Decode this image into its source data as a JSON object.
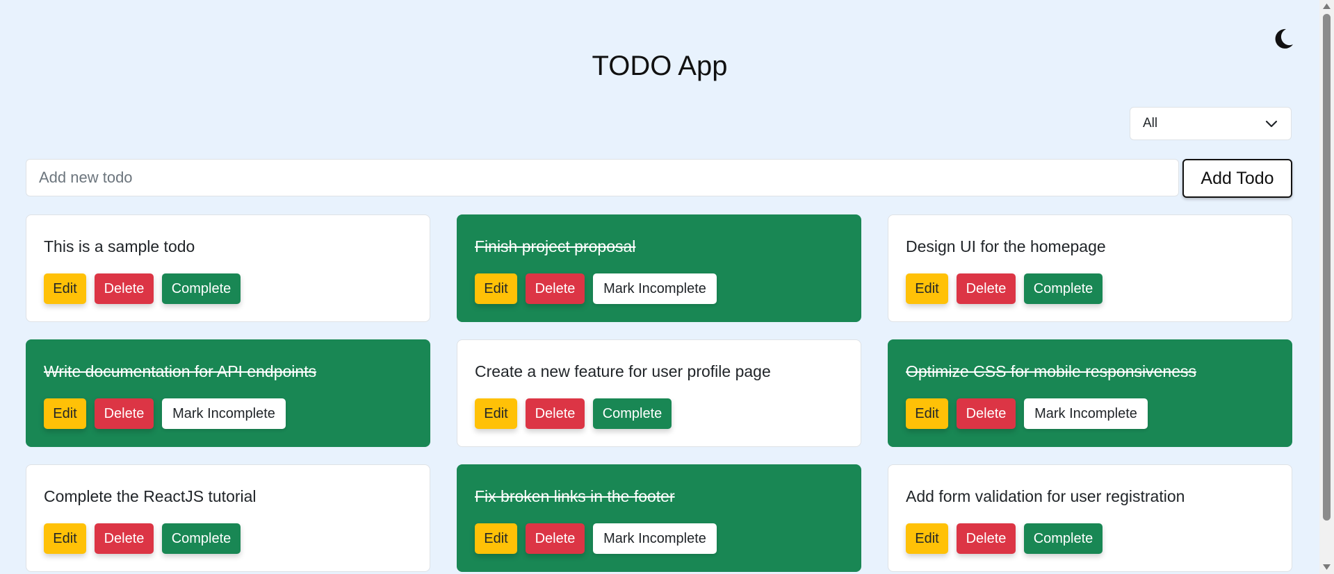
{
  "app": {
    "title": "TODO App"
  },
  "icons": {
    "theme_toggle": "moon-icon",
    "filter_chevron": "chevron-down-icon"
  },
  "filter": {
    "selected": "All"
  },
  "add": {
    "placeholder": "Add new todo",
    "value": "",
    "button_label": "Add Todo"
  },
  "buttons": {
    "edit": "Edit",
    "delete": "Delete",
    "complete": "Complete",
    "mark_incomplete": "Mark Incomplete"
  },
  "colors": {
    "background": "#e8f2fd",
    "completed_card": "#198754",
    "edit": "#ffc107",
    "delete": "#dc3545",
    "complete": "#198754"
  },
  "todos": [
    {
      "text": "This is a sample todo",
      "completed": false
    },
    {
      "text": "Finish project proposal",
      "completed": true
    },
    {
      "text": "Design UI for the homepage",
      "completed": false
    },
    {
      "text": "Write documentation for API endpoints",
      "completed": true
    },
    {
      "text": "Create a new feature for user profile page",
      "completed": false
    },
    {
      "text": "Optimize CSS for mobile responsiveness",
      "completed": true
    },
    {
      "text": "Complete the ReactJS tutorial",
      "completed": false
    },
    {
      "text": "Fix broken links in the footer",
      "completed": true
    },
    {
      "text": "Add form validation for user registration",
      "completed": false
    }
  ]
}
